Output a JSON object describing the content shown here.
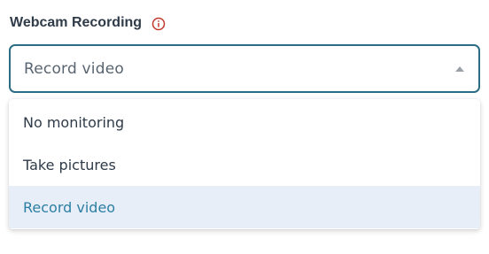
{
  "label": {
    "text": "Webcam Recording",
    "info_icon": "info-icon",
    "info_color": "#c0392b"
  },
  "select": {
    "value": "Record video",
    "caret_icon": "caret-up-icon"
  },
  "options": [
    {
      "label": "No monitoring",
      "selected": false
    },
    {
      "label": "Take pictures",
      "selected": false
    },
    {
      "label": "Record video",
      "selected": true
    }
  ],
  "colors": {
    "border_accent": "#2c6d85",
    "selected_bg": "#e8eef7",
    "selected_text": "#2c7fa3"
  }
}
